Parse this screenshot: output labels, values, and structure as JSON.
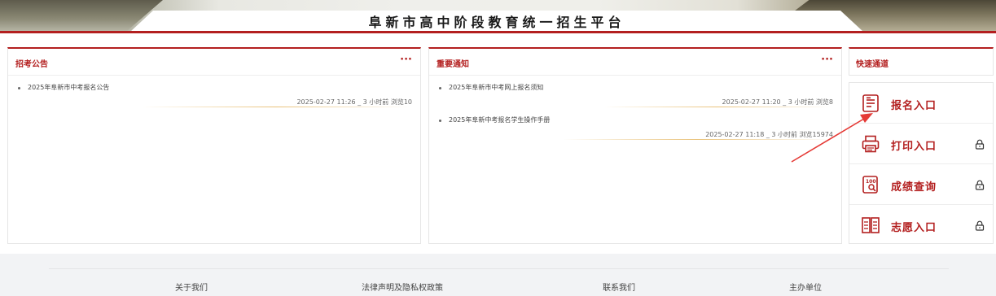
{
  "site": {
    "title": "阜新市高中阶段教育统一招生平台"
  },
  "colors": {
    "brand_red": "#b31f1f",
    "underline_gold": "#e9c27a",
    "annotation_arrow": "#e53935"
  },
  "announcements": {
    "title": "招考公告",
    "more_icon": "more-dots-icon",
    "more_label": "···",
    "items": [
      {
        "title": "2025年阜新市中考报名公告",
        "meta": "2025-02-27 11:26 _ 3 小时前 浏览10"
      }
    ]
  },
  "notices": {
    "title": "重要通知",
    "more_icon": "more-dots-icon",
    "more_label": "···",
    "items": [
      {
        "title": "2025年阜新市中考网上报名须知",
        "meta": "2025-02-27 11:20 _ 3 小时前 浏览8"
      },
      {
        "title": "2025年阜新中考报名学生操作手册",
        "meta": "2025-02-27 11:18 _ 3 小时前 浏览15974"
      }
    ]
  },
  "quick": {
    "title": "快速通道",
    "items": [
      {
        "label": "报名入口",
        "icon": "registration-form-icon",
        "locked": false
      },
      {
        "label": "打印入口",
        "icon": "printer-icon",
        "locked": true
      },
      {
        "label": "成绩查询",
        "icon": "score-search-icon",
        "locked": true
      },
      {
        "label": "志愿入口",
        "icon": "open-book-icon",
        "locked": true
      }
    ]
  },
  "footer": {
    "links": [
      "关于我们",
      "法律声明及隐私权政策",
      "联系我们",
      "主办单位"
    ]
  }
}
